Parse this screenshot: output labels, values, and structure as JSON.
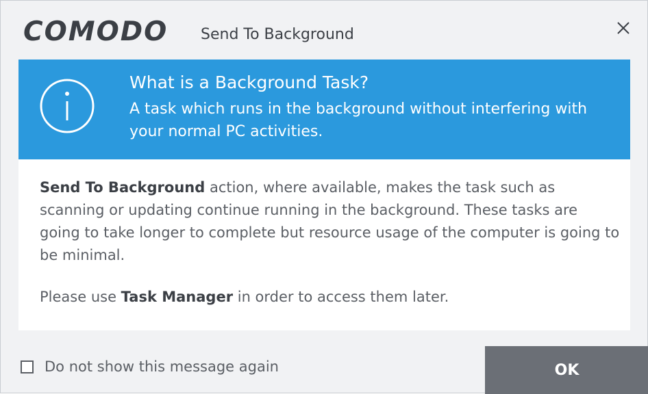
{
  "header": {
    "logo_text": "COMODO",
    "title": "Send To Background",
    "close_icon": "close-icon"
  },
  "info": {
    "icon": "info-icon",
    "title": "What is a Background Task?",
    "description": "A task which runs in the background without interfering with your normal PC activities.",
    "color": "#2b99dd"
  },
  "body": {
    "p1_bold": "Send To Background",
    "p1_rest": " action, where available, makes the task such as scanning or updating continue running in the background. These tasks are going to take longer to complete but resource usage of the computer is going to be minimal.",
    "p2_before": "Please use ",
    "p2_bold": "Task Manager",
    "p2_after": " in order to access them later."
  },
  "footer": {
    "checkbox_label": "Do not show this message again",
    "checkbox_checked": false,
    "ok_label": "OK",
    "ok_color": "#6b6f76"
  }
}
